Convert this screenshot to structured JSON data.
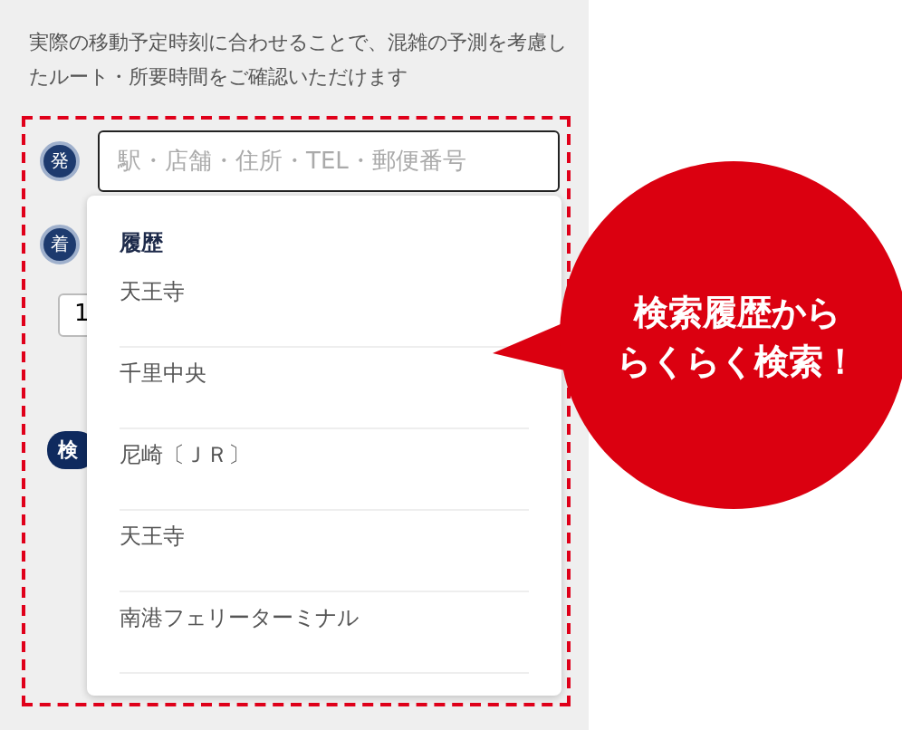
{
  "description": "実際の移動予定時刻に合わせることで、混雑の予測を考慮したルート・所要時間をご確認いただけます",
  "from": {
    "pin": "発",
    "placeholder": "駅・店舗・住所・TEL・郵便番号"
  },
  "to": {
    "pin": "着"
  },
  "time_field": {
    "value": "1"
  },
  "search_button": {
    "label": "検"
  },
  "history": {
    "heading": "履歴",
    "items": [
      {
        "label": "天王寺"
      },
      {
        "label": "千里中央"
      },
      {
        "label": "尼崎〔ＪＲ〕"
      },
      {
        "label": "天王寺"
      },
      {
        "label": "南港フェリーターミナル"
      }
    ]
  },
  "callout": {
    "lines": [
      "検索履歴から",
      "らくらく検索！"
    ]
  }
}
